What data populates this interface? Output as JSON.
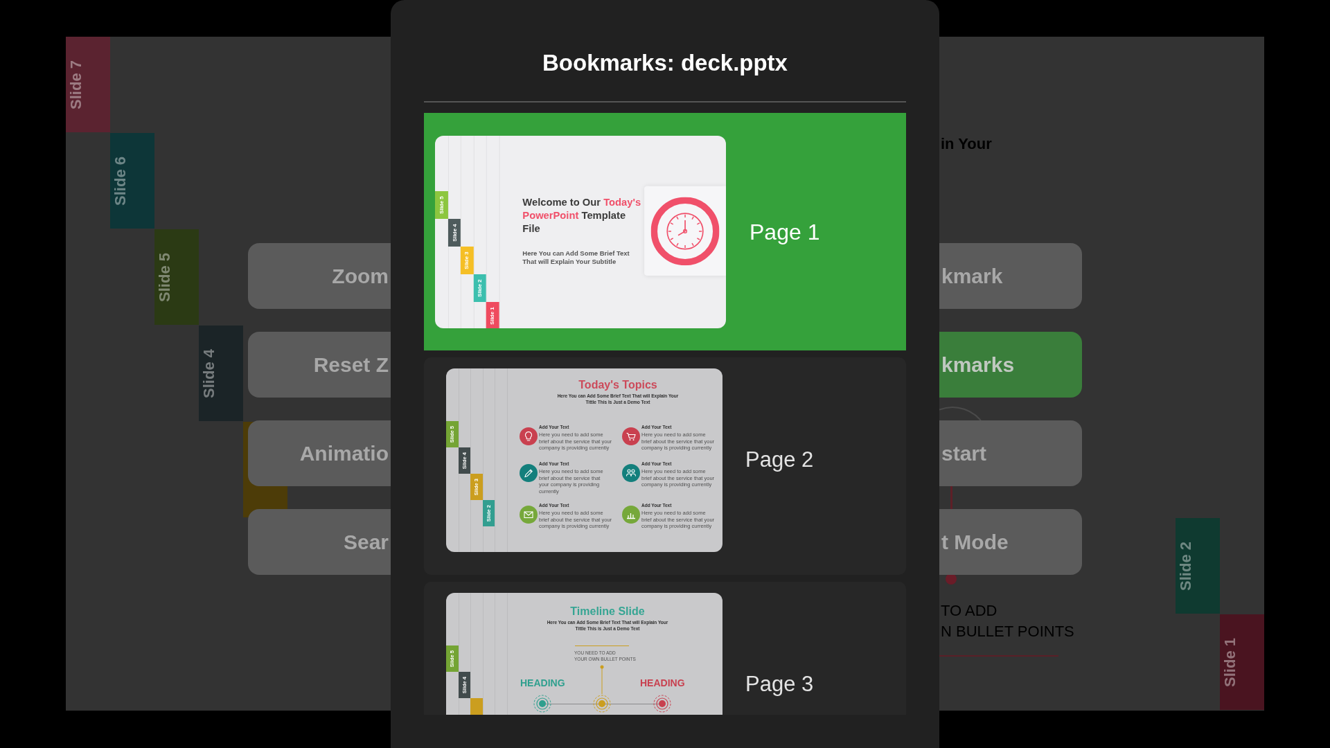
{
  "viewer": {
    "slide_tabs": [
      {
        "label": "Slide 7",
        "color": "#5b2330"
      },
      {
        "label": "Slide 6",
        "color": "#0d3638"
      },
      {
        "label": "Slide 5",
        "color": "#2b3a14"
      },
      {
        "label": "Slide 4",
        "color": "#1b2427"
      },
      {
        "color": "#4d3c08"
      },
      {
        "label": "Slide 2",
        "color": "#0f3a30"
      },
      {
        "label": "Slide 1",
        "color": "#4a1420"
      }
    ],
    "button_columns": [
      [
        {
          "label": "Zoom",
          "selected": false
        },
        {
          "label": "Reset Z",
          "selected": false
        },
        {
          "label": "Animatio",
          "selected": false
        },
        {
          "label": "Sear",
          "selected": false
        }
      ],
      [
        {
          "label": "kmark",
          "selected": false
        },
        {
          "label": "kmarks",
          "selected": true
        },
        {
          "label": "start",
          "selected": false
        },
        {
          "label": "t Mode",
          "selected": false
        }
      ]
    ],
    "slide_text": {
      "subtitle": "in Your",
      "bullets": [
        "TO ADD",
        "N BULLET POINTS"
      ]
    }
  },
  "dialog": {
    "title": "Bookmarks: deck.pptx",
    "bookmarks": [
      {
        "label": "Page 1",
        "selected": true,
        "thumbnail": {
          "kind": "title",
          "side_tabs": [
            {
              "label": "Slide 5",
              "color": "#8cc63f"
            },
            {
              "label": "Slide 4",
              "color": "#4e5b5c"
            },
            {
              "label": "Slide 3",
              "color": "#f5bf26"
            },
            {
              "label": "Slide 2",
              "color": "#3cbfae"
            },
            {
              "label": "Slide 1",
              "color": "#ef4b5f"
            }
          ],
          "title": [
            {
              "text": "Welcome to Our ",
              "highlight": false
            },
            {
              "text": "Today's PowerPoint",
              "highlight": true
            },
            {
              "text": " Template File",
              "highlight": false
            }
          ],
          "subtitle": [
            "Here You can Add Some Brief Text",
            "That will Explain Your Subtitle"
          ]
        }
      },
      {
        "label": "Page 2",
        "selected": false,
        "thumbnail": {
          "kind": "topics",
          "side_tabs": [
            {
              "label": "Slide 5",
              "color": "#74a434"
            },
            {
              "label": "Slide 4",
              "color": "#414b4c"
            },
            {
              "label": "Slide 3",
              "color": "#cb9e1f"
            },
            {
              "label": "Slide 2",
              "color": "#329e90"
            }
          ],
          "title": "Today's Topics",
          "subtitle": [
            "Here You can Add Some Brief Text That will Explain Your",
            "Tittle This Is Just a Demo Text"
          ],
          "topics": [
            {
              "heading": "Add Your Text",
              "text": [
                "Here you need to add some",
                "brief about the service that your",
                "company is providing currently"
              ],
              "color": "#c9404f"
            },
            {
              "heading": "Add Your Text",
              "text": [
                "Here you need to add some",
                "brief about the service that your",
                "company is providing currently"
              ],
              "color": "#c9404f"
            },
            {
              "heading": "Add Your Text",
              "text": [
                "Here you need to add some",
                "brief about the service that",
                "your company is providing",
                "currently"
              ],
              "color": "#137f7c"
            },
            {
              "heading": "Add Your Text",
              "text": [
                "Here you need to add some",
                "brief about the service that your",
                "company is providing currently"
              ],
              "color": "#137f7c"
            },
            {
              "heading": "Add Your Text",
              "text": [
                "Here you need to add some",
                "brief about the service that your",
                "company is providing currently"
              ],
              "color": "#76a83a"
            },
            {
              "heading": "Add Your Text",
              "text": [
                "Here you need to add some",
                "brief about the service that your",
                "company is providing currently"
              ],
              "color": "#76a83a"
            }
          ]
        }
      },
      {
        "label": "Page 3",
        "selected": false,
        "thumbnail": {
          "kind": "timeline",
          "side_tabs": [
            {
              "label": "Slide 5",
              "color": "#74a434"
            },
            {
              "label": "Slide 4",
              "color": "#414b4c"
            },
            {
              "color": "#cb9e1f"
            }
          ],
          "title": "Timeline Slide",
          "subtitle": [
            "Here You can Add Some Brief Text That will Explain Your",
            "Tittle This is Just a Demo Text"
          ],
          "note": [
            "YOU NEED TO ADD",
            "YOUR OWN BULLET POINTS"
          ],
          "headings": [
            {
              "text": "HEADING",
              "color": "#2e9f8e"
            },
            {
              "text": "HEADING",
              "color": "#c8404f"
            }
          ],
          "markers": [
            {
              "color": "#2e9f8e"
            },
            {
              "color": "#cb9e1f"
            },
            {
              "color": "#c8404f"
            }
          ]
        }
      }
    ]
  }
}
